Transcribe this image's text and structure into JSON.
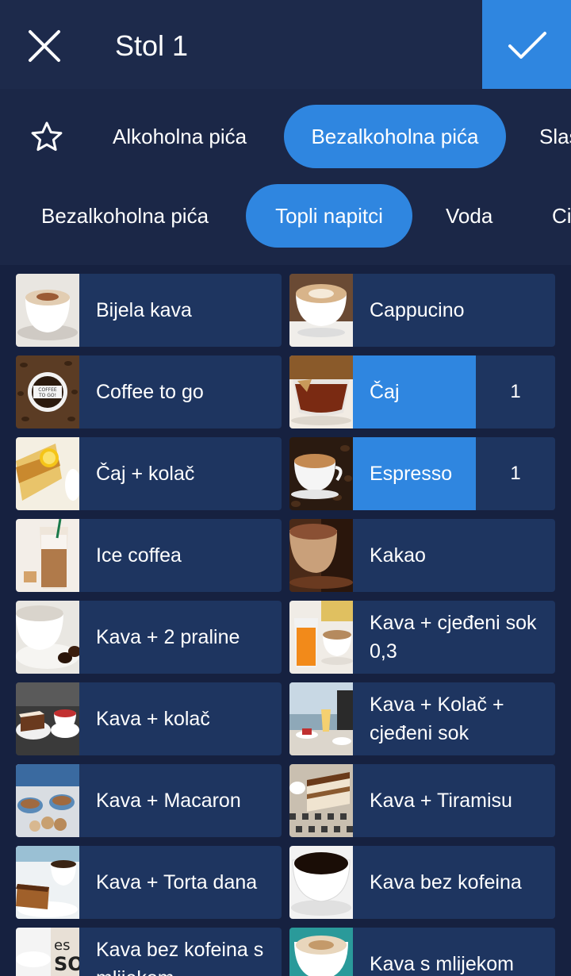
{
  "header": {
    "title": "Stol 1"
  },
  "categories": [
    "Alkoholna pića",
    "Bezalkoholna pića",
    "Slas"
  ],
  "subcategories": [
    "Bezalkoholna pića",
    "Topli napitci",
    "Voda",
    "Ci"
  ],
  "active_category": "Bezalkoholna pića",
  "active_subcategory": "Topli napitci",
  "colors": {
    "accent": "#2f86e0",
    "header_bg": "#1d2a4b",
    "tile_bg": "#1e3560",
    "page_bg": "#182443"
  },
  "products": [
    {
      "name": "Bijela kava",
      "qty": null
    },
    {
      "name": "Cappucino",
      "qty": null
    },
    {
      "name": "Coffee to go",
      "qty": null
    },
    {
      "name": "Čaj",
      "qty": "1"
    },
    {
      "name": "Čaj + kolač",
      "qty": null
    },
    {
      "name": "Espresso",
      "qty": "1"
    },
    {
      "name": "Ice coffea",
      "qty": null
    },
    {
      "name": "Kakao",
      "qty": null
    },
    {
      "name": "Kava + 2 praline",
      "qty": null
    },
    {
      "name": "Kava + cjeđeni sok 0,3",
      "qty": null
    },
    {
      "name": "Kava + kolač",
      "qty": null
    },
    {
      "name": "Kava + Kolač + cjeđeni sok",
      "qty": null
    },
    {
      "name": "Kava + Macaron",
      "qty": null
    },
    {
      "name": "Kava + Tiramisu",
      "qty": null
    },
    {
      "name": "Kava + Torta dana",
      "qty": null
    },
    {
      "name": "Kava bez kofeina",
      "qty": null
    },
    {
      "name": "Kava bez kofeina s mlijekom",
      "qty": null
    },
    {
      "name": "Kava s mlijekom",
      "qty": null
    }
  ]
}
